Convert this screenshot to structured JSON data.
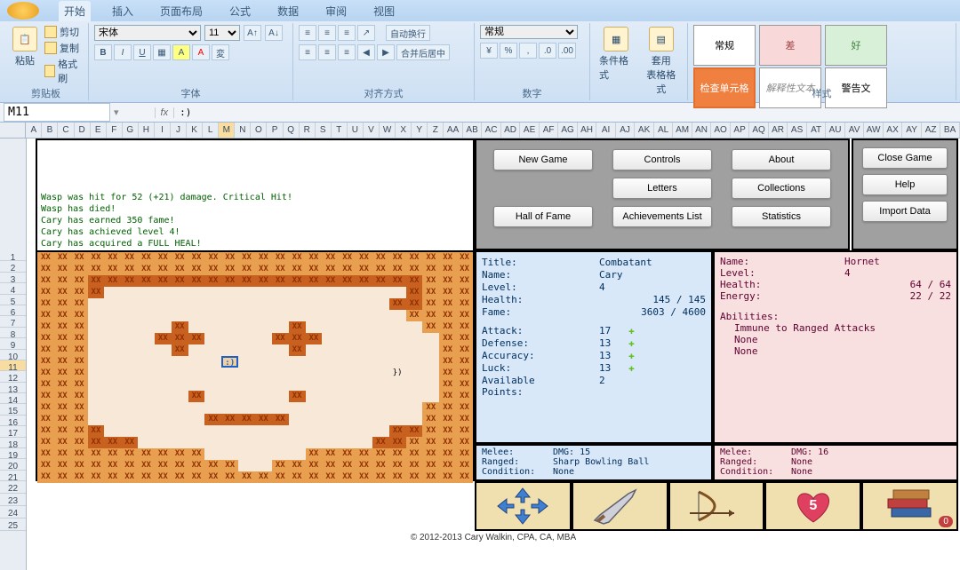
{
  "ribbon": {
    "tabs": [
      "开始",
      "插入",
      "页面布局",
      "公式",
      "数据",
      "审阅",
      "视图"
    ],
    "groups": {
      "clipboard": {
        "label": "剪贴板",
        "paste": "粘贴",
        "cut": "剪切",
        "copy": "复制",
        "fmt": "格式刷"
      },
      "font": {
        "label": "字体",
        "name": "宋体",
        "size": "11"
      },
      "align": {
        "label": "对齐方式",
        "wrap": "自动换行",
        "merge": "合并后居中"
      },
      "number": {
        "label": "数字",
        "fmt": "常规"
      },
      "cond": {
        "cond": "条件格式",
        "table": "套用\n表格格式"
      },
      "styles": {
        "label": "样式",
        "normal": "常规",
        "bad": "差",
        "good": "好",
        "check": "检查单元格",
        "explain": "解释性文本",
        "warn": "警告文"
      }
    }
  },
  "formula": {
    "namebox": "M11",
    "fx": "fx",
    "value": ":)"
  },
  "cols1": [
    "A",
    "B",
    "C",
    "D",
    "E",
    "F",
    "G",
    "H",
    "I",
    "J",
    "K",
    "L",
    "M",
    "N",
    "O",
    "P",
    "Q",
    "R",
    "S",
    "T",
    "U",
    "V",
    "W",
    "X",
    "Y",
    "Z"
  ],
  "cols2": [
    "AA",
    "AB",
    "AC",
    "AD",
    "AE",
    "AF",
    "AG",
    "AH",
    "AI",
    "AJ",
    "AK",
    "AL",
    "AM",
    "AN",
    "AO",
    "AP",
    "AQ",
    "AR",
    "AS",
    "AT",
    "AU",
    "AV",
    "AW",
    "AX",
    "AY",
    "AZ",
    "BA"
  ],
  "buttons": {
    "newgame": "New Game",
    "controls": "Controls",
    "about": "About",
    "letters": "Letters",
    "collections": "Collections",
    "hof": "Hall of Fame",
    "achieve": "Achievements List",
    "stats": "Statistics",
    "close": "Close Game",
    "help": "Help",
    "import": "Import Data"
  },
  "log": [
    "Wasp was hit for 52 (+21) damage. Critical Hit!",
    "Wasp has died!",
    "Cary has earned 350 fame!",
    "Cary has achieved level 4!",
    "Cary has acquired a FULL HEAL!"
  ],
  "player": {
    "title_l": "Title:",
    "title_v": "Combatant",
    "name_l": "Name:",
    "name_v": "Cary",
    "level_l": "Level:",
    "level_v": "4",
    "health_l": "Health:",
    "health_v": "145 / 145",
    "fame_l": "Fame:",
    "fame_v": "3603 / 4600",
    "attack_l": "Attack:",
    "attack_v": "17",
    "defense_l": "Defense:",
    "defense_v": "13",
    "accuracy_l": "Accuracy:",
    "accuracy_v": "13",
    "luck_l": "Luck:",
    "luck_v": "13",
    "ap_l": "Available Points:",
    "ap_v": "2",
    "melee_l": "Melee:",
    "melee_v": "DMG: 15",
    "ranged_l": "Ranged:",
    "ranged_v": "Sharp Bowling Ball",
    "cond_l": "Condition:",
    "cond_v": "None"
  },
  "enemy": {
    "name_l": "Name:",
    "name_v": "Hornet",
    "level_l": "Level:",
    "level_v": "4",
    "health_l": "Health:",
    "health_v": "64 / 64",
    "energy_l": "Energy:",
    "energy_v": "22 / 22",
    "abil_l": "Abilities:",
    "abil1": "Immune to Ranged Attacks",
    "abil2": "None",
    "abil3": "None",
    "melee_l": "Melee:",
    "melee_v": "DMG: 16",
    "ranged_l": "Ranged:",
    "ranged_v": "None",
    "cond_l": "Condition:",
    "cond_v": "None"
  },
  "heart_count": "5",
  "book_count": "0",
  "copyright": "© 2012-2013 Cary Walkin, CPA, CA, MBA",
  "map_cell": "XX",
  "map_special": "})",
  "map_player": ":)"
}
